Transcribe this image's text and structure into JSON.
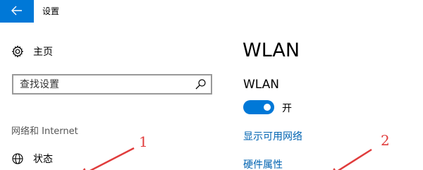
{
  "window": {
    "title": "设置",
    "back_icon": "arrow-left-icon",
    "accent_color": "#0078d7"
  },
  "sidebar": {
    "home": {
      "label": "主页",
      "icon": "gear-icon"
    },
    "search": {
      "placeholder": "查找设置",
      "icon": "search-icon"
    },
    "section_label": "网络和 Internet",
    "items": [
      {
        "label": "状态",
        "icon": "globe-icon"
      }
    ]
  },
  "main": {
    "page_title": "WLAN",
    "wlan_heading": "WLAN",
    "toggle": {
      "state_label": "开",
      "on": true
    },
    "links": [
      {
        "label": "显示可用网络"
      },
      {
        "label": "硬件属性"
      }
    ],
    "link_color": "#0063b1"
  },
  "annotations": {
    "marker_1": "1",
    "marker_2": "2",
    "color": "#e03c3c"
  }
}
